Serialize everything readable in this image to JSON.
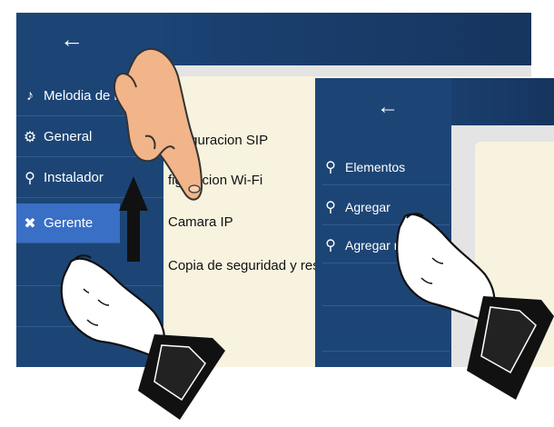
{
  "left_screen": {
    "back_icon": "arrow-left-icon",
    "sidebar": [
      {
        "icon": "music-note-icon",
        "label": "Melodia de lla"
      },
      {
        "icon": "gear-icon",
        "label": "General"
      },
      {
        "icon": "wrench-icon",
        "label": "Instalador"
      },
      {
        "icon": "tools-icon",
        "label": "Gerente",
        "active": true
      }
    ],
    "menu": [
      "onfiguracion SIP",
      "figuracion Wi-Fi",
      "Camara IP",
      "Copia de seguridad y resta."
    ]
  },
  "right_screen": {
    "back_icon": "arrow-left-icon",
    "sidebar": [
      {
        "icon": "wrench-icon",
        "label": "Elementos"
      },
      {
        "icon": "wrench-icon",
        "label": "Agregar"
      },
      {
        "icon": "wrench-icon",
        "label": "Agregar m"
      }
    ]
  },
  "colors": {
    "sidebar_bg": "#1c4576",
    "active_item": "#3a6fc6",
    "panel_bg": "#f7f3df",
    "screen_bg": "#e4e4e4"
  },
  "gestures": [
    "scroll-up-gesture",
    "tap-gesture"
  ]
}
